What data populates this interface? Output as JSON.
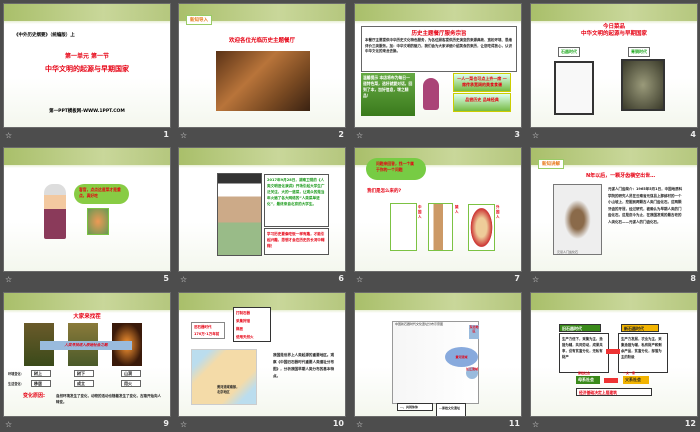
{
  "slides": [
    {
      "num": "1",
      "book": "《中外历史纲要》（统编版）上",
      "unit": "第一单元  第一节",
      "title": "中华文明的起源与早期国家",
      "site": "第一PPT模板网-WWW.1PPT.COM"
    },
    {
      "num": "2",
      "tag": "新知导入",
      "title": "欢迎各位光临历史主题餐厅"
    },
    {
      "num": "3",
      "title": "历史主题餐厅服务宗旨",
      "body": "本餐厅主要提供中华历史文化特色服务，为各位顾客提供历史演变的来源典故、宽松环境、思维评价三类服务。加：中华文明的魅力，我们会为大家详细介绍美食的来历，让您吃得放心，认识中华文化的来龙去脉。",
      "left": "温馨提示 本店将布为每日一道特色菜，选好就要对话，回到了本，加好信息，增之精品！",
      "right1": "一人一菜也可点上齐一席 一席传承宽阔的美食食谱",
      "right2": "品尝历史 品味经典"
    },
    {
      "num": "4",
      "title1": "今日菜品",
      "title2": "中华文明的起源与早期国家",
      "label1": "石器时代",
      "label2": "青铜时代"
    },
    {
      "num": "5",
      "bubble": "客官，点点这道菜才是重点，真好吃"
    },
    {
      "num": "6",
      "text1": "2017年9月28日，湖南卫视的《人类文明进化演讲》开场引起大学生广泛关注，大的一道菜，让观众的是当年火遍了各大网络的“人类菜单进化”，最终来自北京的大学生。",
      "text2": "学习历史要像吃饭一样有趣，才能引起兴趣，思想才会在历史的长河中翱翔！"
    },
    {
      "num": "7",
      "bubble": "问题来回答，找一个属于你的一个问题",
      "question": "我们是怎么来的?",
      "labels": [
        "中国人",
        "猿人",
        "外国人"
      ]
    },
    {
      "num": "8",
      "tag": "新知讲解",
      "title": "N年以后，一颗牙齿横空出世…",
      "caption": "元谋人门齿化石",
      "body": "元谋人门齿简介：1965年5月1日，中国地质科学院的研究人员在云南省元谋县上那蚌村的一个小山坡上，挖掘到两颗古人类门齿化石。这两颗牙齿的牙冠，经过研究，被确认为早期人类的门齿化石。这是迄今为止，在我国发现的最古老的人类化石——元谋人的门齿化石。"
    },
    {
      "num": "9",
      "title": "大家来找茬",
      "banner": "人类寻找进入原始社会之路",
      "row1label": "环境变化：",
      "row2label": "生活变化：",
      "row1": [
        "树上",
        "树下",
        "山洞"
      ],
      "row2": [
        "移居",
        "成立",
        "用火"
      ],
      "reason_label": "变化原因:",
      "reason": "自然环境发生了变化，动物的活动也随着发生了变化，古猿开始向人转变。"
    },
    {
      "num": "10",
      "era": "旧石器时代",
      "years": "170万-1万年前",
      "list": [
        "打制石器",
        "采集狩猎",
        "群居",
        "使用天然火"
      ],
      "map_label": "黄河流域南部，北京地区",
      "body": "我国是世界上人类起源的重要地区。观察《中国旧石器时代重要人类遗址分布图》，分析我国早期人类分布的基本特点。"
    },
    {
      "num": "11",
      "map_title": "中国新石器时代文化遗址分布示意图",
      "region1": "东北地区",
      "region2": "黄河流域",
      "region3": "长江流域",
      "note1": "…，共同体体",
      "note2": "…原始文化遗址"
    },
    {
      "num": "12",
      "head1": "旧石器时代",
      "head2": "新石器时代",
      "col1": "生产力低下，采集为主，渔猎为辅，共同劳动，成果共享，没有贫富分化，无私有财产",
      "col2": "生产力发展，农业为主，采集渔猎为辅，私有财产和剩余产品，贫富分化，部落为主的阶级",
      "soc1": "母系社会",
      "soc2": "父系社会",
      "arrow1": "原始社会",
      "arrow2": "一夫一妻",
      "footer": "经济基础决定上层建筑"
    }
  ],
  "colors": {
    "red": "#e60012",
    "green": "#3c8c1c",
    "frame": "#7cc243",
    "background": "#4d4d4d"
  }
}
